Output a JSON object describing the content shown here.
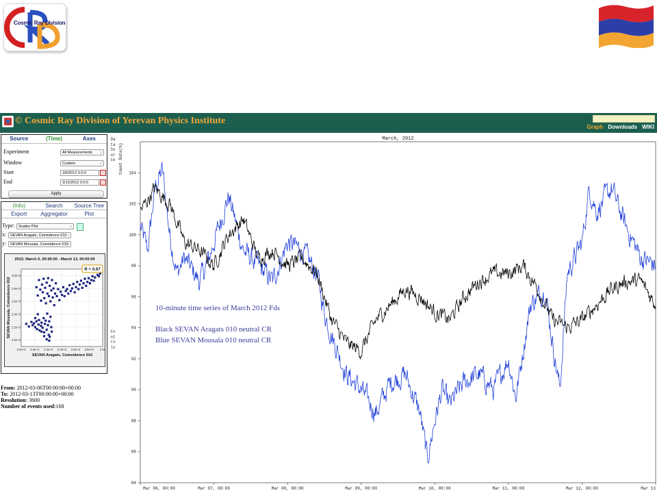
{
  "logo": {
    "text": "Cosmic Ray Division"
  },
  "header": {
    "title": "© Cosmic Ray Division of Yerevan Physics Institute",
    "search_value": "",
    "nav": [
      "Graph",
      "Downloads",
      "WIKI"
    ]
  },
  "source_panel": {
    "tabs": [
      "Source",
      "(Time)",
      "Axes"
    ],
    "experiment_label": "Experiment",
    "experiment_value": "All Measurements",
    "window_label": "Window",
    "window_value": "Custom",
    "start_label": "Start",
    "start_value": "3/6/2012 0:0:0",
    "end_label": "End",
    "end_value": "3/13/2012 0:0:0",
    "apply_label": "Apply"
  },
  "plot_panel": {
    "tabs_row1": [
      "(Info)",
      "Search",
      "Source Tree"
    ],
    "tabs_row2": [
      "Export",
      "Aggregator",
      "Plot"
    ],
    "type_label": "Type:",
    "type_value": "Scatter Plot",
    "x_label": "x:",
    "x_value": "SEVAN Aragats, Coinsidence 010",
    "y_label": "y:",
    "y_value": "SEVAN Mousala, Coinsidence 010"
  },
  "side_strip": {
    "top": "Data Source",
    "bottom": "Controls"
  },
  "info": {
    "from_label": "From:",
    "from_value": "2012-03-06T00:00:00+00:00",
    "to_label": "To:",
    "to_value": "2012-03-13T00:00:00+00:00",
    "resolution_label": "Resolution:",
    "resolution_value": "3600",
    "events_label": "Number of events used:",
    "events_value": "168"
  },
  "annotations": {
    "line1": "10-minute time series of March 2012 Fds",
    "line2": "Black SEVAN Aragats 010 neutral CR",
    "line3": "Blue SEVAN Mousala 010 neutral CR"
  },
  "colors": {
    "header_bg": "#1d5f4f",
    "title": "#f2a83a",
    "active_nav": "#f5a623",
    "black_series": "#000000",
    "blue_series": "#1e3fd8",
    "scatter_points": "#1a237e"
  },
  "chart_data": [
    {
      "type": "line",
      "title": "March, 2012",
      "ylabel": "Count Rate(%)",
      "xlabel": "",
      "x_tick_labels": [
        "Mar 06, 00:00",
        "Mar 07, 00:00",
        "Mar 08, 00:00",
        "Mar 09, 00:00",
        "Mar 10, 00:00",
        "Mar 11, 00:00",
        "Mar 12, 00:00",
        "Mar 13"
      ],
      "y_ticks": [
        84,
        86,
        88,
        90,
        92,
        94,
        96,
        98,
        100,
        102,
        104
      ],
      "ylim": [
        84,
        106
      ],
      "grid": false,
      "series": [
        {
          "color": "#000000",
          "x": [
            0,
            0.2,
            0.4,
            0.6,
            0.8,
            1.0,
            1.2,
            1.4,
            1.6,
            1.8,
            2.0,
            2.2,
            2.4,
            2.5,
            2.6,
            2.8,
            3.0,
            3.2,
            3.4,
            3.6,
            3.8,
            4.0,
            4.2,
            4.4,
            4.6,
            4.8,
            5.0,
            5.2,
            5.4,
            5.6,
            5.8,
            6.0,
            6.2,
            6.4,
            6.6,
            6.8,
            7.0
          ],
          "y": [
            101.5,
            103.0,
            102.0,
            99.5,
            99.0,
            98.0,
            100.0,
            101.0,
            98.5,
            99.0,
            98.0,
            98.5,
            97.5,
            96.0,
            94.5,
            93.0,
            92.5,
            94.5,
            95.5,
            96.5,
            96.0,
            95.0,
            94.5,
            96.0,
            97.0,
            97.5,
            97.5,
            98.0,
            96.5,
            94.5,
            94.0,
            94.5,
            95.5,
            96.5,
            97.0,
            97.0,
            95.5
          ]
        },
        {
          "color": "#1e3fd8",
          "x": [
            0,
            0.1,
            0.2,
            0.3,
            0.4,
            0.5,
            0.6,
            0.8,
            0.9,
            1.0,
            1.2,
            1.4,
            1.6,
            1.8,
            2.0,
            2.2,
            2.4,
            2.5,
            2.6,
            2.8,
            3.0,
            3.2,
            3.4,
            3.6,
            3.8,
            3.9,
            4.0,
            4.1,
            4.2,
            4.4,
            4.6,
            4.8,
            5.0,
            5.1,
            5.3,
            5.5,
            5.6,
            5.7,
            5.8,
            6.0,
            6.1,
            6.2,
            6.4,
            6.6,
            6.8,
            7.0
          ],
          "y": [
            100.5,
            99.0,
            103.0,
            104.2,
            100.0,
            97.5,
            98.5,
            97.0,
            98.0,
            99.5,
            102.5,
            99.0,
            98.0,
            97.0,
            99.5,
            99.0,
            97.5,
            95.0,
            93.5,
            91.0,
            90.0,
            88.5,
            90.5,
            91.0,
            88.5,
            85.5,
            88.0,
            90.0,
            89.0,
            90.5,
            91.0,
            90.0,
            92.0,
            89.5,
            95.5,
            96.5,
            93.0,
            90.0,
            97.5,
            99.5,
            103.0,
            101.5,
            103.0,
            100.5,
            98.5,
            98.0
          ]
        }
      ]
    },
    {
      "type": "scatter",
      "title": "2012; March 6, 00:00:00 - March 13, 00:00:00",
      "xlabel": "SEVAN Aragats, Coinsidence 010",
      "ylabel": "SEVAN Mousala, Coinsidence 010",
      "annotation": "R = 0.67",
      "x_tick_labels": [
        "2.3e+3",
        "2.4e+3",
        "2.4e+3",
        "2.4e+3",
        "2.5e+3",
        "2.6e+3",
        "2.6e"
      ],
      "y_tick_labels": [
        "2.0e+3",
        "2.2e+3",
        "2.4e+3",
        "2.6e+3",
        "2.8e+3",
        "3.0e+3"
      ],
      "xlim": [
        2300,
        2620
      ],
      "ylim": [
        1900,
        3100
      ],
      "grid": true,
      "points": [
        [
          2320,
          2250
        ],
        [
          2330,
          2210
        ],
        [
          2340,
          2280
        ],
        [
          2345,
          2230
        ],
        [
          2350,
          2260
        ],
        [
          2355,
          2200
        ],
        [
          2360,
          2290
        ],
        [
          2362,
          2170
        ],
        [
          2368,
          2240
        ],
        [
          2370,
          2310
        ],
        [
          2372,
          2150
        ],
        [
          2378,
          2220
        ],
        [
          2380,
          2270
        ],
        [
          2384,
          2190
        ],
        [
          2388,
          2340
        ],
        [
          2390,
          2120
        ],
        [
          2393,
          2250
        ],
        [
          2396,
          2300
        ],
        [
          2400,
          2160
        ],
        [
          2402,
          2410
        ],
        [
          2405,
          2230
        ],
        [
          2408,
          2080
        ],
        [
          2410,
          2290
        ],
        [
          2412,
          2050
        ],
        [
          2415,
          2360
        ],
        [
          2418,
          2200
        ],
        [
          2420,
          2130
        ],
        [
          2360,
          2820
        ],
        [
          2365,
          2690
        ],
        [
          2370,
          2930
        ],
        [
          2375,
          2780
        ],
        [
          2378,
          2610
        ],
        [
          2382,
          2860
        ],
        [
          2385,
          2740
        ],
        [
          2388,
          2950
        ],
        [
          2391,
          2650
        ],
        [
          2394,
          2810
        ],
        [
          2397,
          2570
        ],
        [
          2400,
          2890
        ],
        [
          2403,
          2720
        ],
        [
          2406,
          2960
        ],
        [
          2409,
          2680
        ],
        [
          2412,
          2840
        ],
        [
          2415,
          2600
        ],
        [
          2418,
          2770
        ],
        [
          2421,
          2930
        ],
        [
          2424,
          2660
        ],
        [
          2427,
          2800
        ],
        [
          2430,
          2540
        ],
        [
          2433,
          2720
        ],
        [
          2436,
          2880
        ],
        [
          2440,
          2680
        ],
        [
          2445,
          2790
        ],
        [
          2450,
          2620
        ],
        [
          2455,
          2750
        ],
        [
          2460,
          2700
        ],
        [
          2465,
          2820
        ],
        [
          2470,
          2680
        ],
        [
          2475,
          2760
        ],
        [
          2480,
          2790
        ],
        [
          2485,
          2720
        ],
        [
          2490,
          2850
        ],
        [
          2495,
          2760
        ],
        [
          2500,
          2800
        ],
        [
          2505,
          2870
        ],
        [
          2510,
          2740
        ],
        [
          2515,
          2820
        ],
        [
          2520,
          2900
        ],
        [
          2525,
          2790
        ],
        [
          2530,
          2860
        ],
        [
          2535,
          2920
        ],
        [
          2540,
          2810
        ],
        [
          2545,
          2880
        ],
        [
          2550,
          2950
        ],
        [
          2555,
          2840
        ],
        [
          2560,
          2900
        ],
        [
          2565,
          2960
        ],
        [
          2570,
          2880
        ],
        [
          2575,
          2930
        ],
        [
          2580,
          2990
        ],
        [
          2585,
          2920
        ],
        [
          2590,
          2970
        ],
        [
          2600,
          3010
        ],
        [
          2605,
          2990
        ],
        [
          2610,
          3030
        ],
        [
          2380,
          2130
        ],
        [
          2390,
          2060
        ],
        [
          2400,
          2010
        ],
        [
          2410,
          1990
        ],
        [
          2355,
          2340
        ],
        [
          2365,
          2400
        ]
      ]
    }
  ]
}
